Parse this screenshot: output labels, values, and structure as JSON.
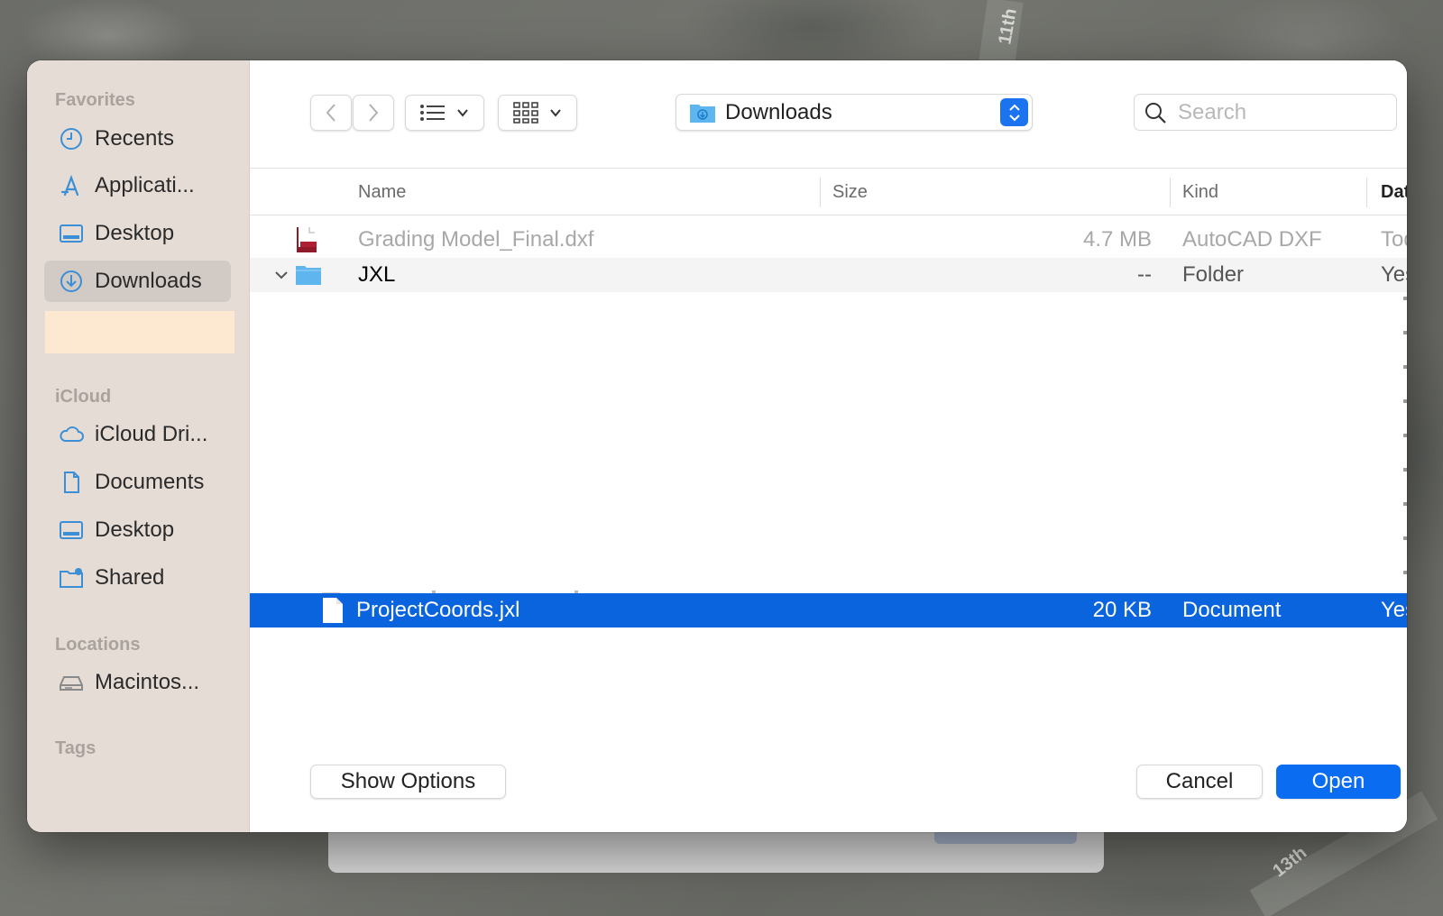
{
  "background": {
    "road_labels": [
      "11th",
      "13th"
    ]
  },
  "sidebar": {
    "sections": {
      "favorites": "Favorites",
      "icloud": "iCloud",
      "locations": "Locations",
      "tags": "Tags"
    },
    "favorites": [
      {
        "label": "Recents",
        "icon": "clock-icon"
      },
      {
        "label": "Applicati...",
        "icon": "applications-icon"
      },
      {
        "label": "Desktop",
        "icon": "desktop-icon"
      },
      {
        "label": "Downloads",
        "icon": "downloads-icon",
        "active": true
      }
    ],
    "icloud": [
      {
        "label": "iCloud Dri...",
        "icon": "cloud-icon"
      },
      {
        "label": "Documents",
        "icon": "document-icon"
      },
      {
        "label": "Desktop",
        "icon": "desktop-icon"
      },
      {
        "label": "Shared",
        "icon": "shared-folder-icon"
      }
    ],
    "locations": [
      {
        "label": "Macintos...",
        "icon": "hard-drive-icon"
      }
    ]
  },
  "toolbar": {
    "location": "Downloads",
    "search_placeholder": "Search"
  },
  "columns": {
    "name": "Name",
    "size": "Size",
    "kind": "Kind",
    "date": "Date A"
  },
  "files": [
    {
      "name": "Grading Model_Final.dxf",
      "size": "4.7 MB",
      "kind": "AutoCAD DXF",
      "date": "Toda",
      "state": "disabled"
    },
    {
      "name": "JXL",
      "size": "--",
      "kind": "Folder",
      "date": "Yeste",
      "state": "expanded"
    },
    {
      "name": "ProjectCoords.jxl",
      "size": "20 KB",
      "kind": "Document",
      "date": "Yeste",
      "state": "selected"
    }
  ],
  "footer": {
    "show_options": "Show Options",
    "cancel": "Cancel",
    "open": "Open"
  },
  "colors": {
    "accent": "#0a64dd",
    "sidebar_bg": "#e6dcd6"
  }
}
